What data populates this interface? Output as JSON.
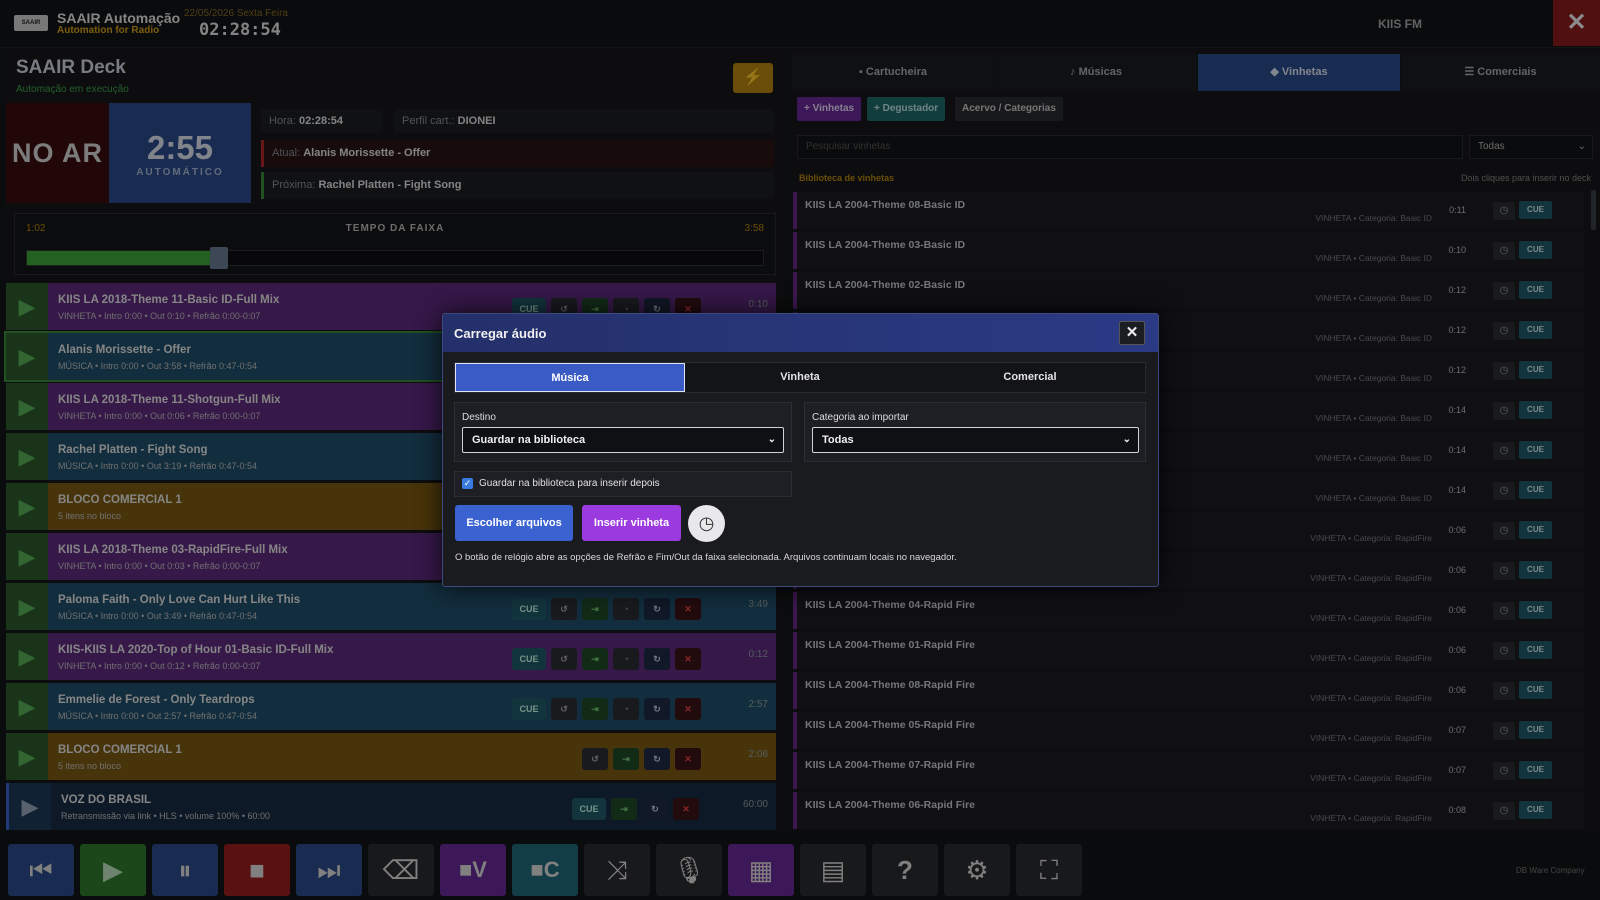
{
  "app": {
    "title": "SAAIR Automação",
    "subtitle": "Automation for Radio",
    "logo_text": "SAAIR",
    "date": "22/05/2026 Sexta Feira",
    "clock": "02:28:54",
    "station": "KIIS FM",
    "close_icon": "close-icon"
  },
  "deck": {
    "title": "SAAIR Deck",
    "status": "Automação em execução",
    "on_air": "NO AR",
    "countdown": "2:55",
    "mode": "AUTOMÁTICO",
    "hora_label": "Hora:",
    "hora": "02:28:54",
    "perfil_label": "Perfil cart.:",
    "perfil": "DIONEI",
    "atual_label": "Atual:",
    "atual": "Alanis Morissette - Offer",
    "proxima_label": "Próxima:",
    "proxima": "Rachel Platten - Fight Song",
    "elapsed": "1:02",
    "track_time_label": "TEMPO DA FAIXA",
    "total": "3:58",
    "progress": 0.26
  },
  "playlist": [
    {
      "title": "KIIS LA 2018-Theme 11-Basic ID-Full Mix",
      "meta": "VINHETA • Intro 0:00 • Out 0:10 • Refrão 0:00-0:07",
      "dur": "0:10",
      "kind": "vinheta",
      "cue": "CUE"
    },
    {
      "title": "Alanis Morissette - Offer",
      "meta": "MÚSICA • Intro 0:00 • Out 3:58 • Refrão 0:47-0:54",
      "dur": "",
      "kind": "musica-active",
      "cue": "CUE"
    },
    {
      "title": "KIIS LA 2018-Theme 11-Shotgun-Full Mix",
      "meta": "VINHETA • Intro 0:00 • Out 0:06 • Refrão 0:00-0:07",
      "dur": "",
      "kind": "vinheta",
      "cue": "CUE"
    },
    {
      "title": "Rachel Platten - Fight Song",
      "meta": "MÚSICA • Intro 0:00 • Out 3:19 • Refrão 0:47-0:54",
      "dur": "",
      "kind": "musica",
      "cue": "CUE"
    },
    {
      "title": "BLOCO COMERCIAL 1",
      "meta": "5 itens no bloco",
      "dur": "",
      "kind": "comercial",
      "cue": "CUE"
    },
    {
      "title": "KIIS LA 2018-Theme 03-RapidFire-Full Mix",
      "meta": "VINHETA • Intro 0:00 • Out 0:03 • Refrão 0:00-0:07",
      "dur": "",
      "kind": "vinheta",
      "cue": "CUE"
    },
    {
      "title": "Paloma Faith - Only Love Can Hurt Like This",
      "meta": "MÚSICA • Intro 0:00 • Out 3:49 • Refrão 0:47-0:54",
      "dur": "3:49",
      "kind": "musica",
      "cue": "CUE"
    },
    {
      "title": "KIIS-KIIS LA 2020-Top of Hour 01-Basic ID-Full Mix",
      "meta": "VINHETA • Intro 0:00 • Out 0:12 • Refrão 0:00-0:07",
      "dur": "0:12",
      "kind": "vinheta",
      "cue": "CUE"
    },
    {
      "title": "Emmelie de Forest - Only Teardrops",
      "meta": "MÚSICA • Intro 0:00 • Out 2:57 • Refrão 0:47-0:54",
      "dur": "2:57",
      "kind": "musica",
      "cue": "CUE"
    },
    {
      "title": "BLOCO COMERCIAL 1",
      "meta": "5 itens no bloco",
      "dur": "2:06",
      "kind": "comercial",
      "cue": ""
    },
    {
      "title": "VOZ DO BRASIL",
      "meta": "Retransmissão via link • HLS • volume 100% • 60:00",
      "dur": "60:00",
      "kind": "voz",
      "cue": "CUE"
    }
  ],
  "tabs": {
    "cartucheira": "Cartucheira",
    "musicas": "Músicas",
    "vinhetas": "Vinhetas",
    "comerciais": "Comerciais"
  },
  "library": {
    "add_vinhetas": "+ Vinhetas",
    "add_degustador": "+ Degustador",
    "acervo": "Acervo / Categorias",
    "search_placeholder": "Pesquisar vinhetas",
    "filter": "Todas",
    "header": "Biblioteca de vinhetas",
    "hint": "Dois cliques para inserir no deck",
    "cue": "CUE",
    "items": [
      {
        "name": "KIIS LA 2004-Theme 08-Basic ID",
        "meta": "VINHETA • Categoria: Basic ID",
        "dur": "0:11"
      },
      {
        "name": "KIIS LA 2004-Theme 03-Basic ID",
        "meta": "VINHETA • Categoria: Basic ID",
        "dur": "0:10"
      },
      {
        "name": "KIIS LA 2004-Theme 02-Basic ID",
        "meta": "VINHETA • Categoria: Basic ID",
        "dur": "0:12"
      },
      {
        "name": "",
        "meta": "VINHETA • Categoria: Basic ID",
        "dur": "0:12"
      },
      {
        "name": "",
        "meta": "VINHETA • Categoria: Basic ID",
        "dur": "0:12"
      },
      {
        "name": "",
        "meta": "VINHETA • Categoria: Basic ID",
        "dur": "0:14"
      },
      {
        "name": "",
        "meta": "VINHETA • Categoria: Basic ID",
        "dur": "0:14"
      },
      {
        "name": "",
        "meta": "VINHETA • Categoria: Basic ID",
        "dur": "0:14"
      },
      {
        "name": "",
        "meta": "VINHETA • Categoria: RapidFire",
        "dur": "0:06"
      },
      {
        "name": "",
        "meta": "VINHETA • Categoria: RapidFire",
        "dur": "0:06"
      },
      {
        "name": "KIIS LA 2004-Theme 04-Rapid Fire",
        "meta": "VINHETA • Categoria: RapidFire",
        "dur": "0:06"
      },
      {
        "name": "KIIS LA 2004-Theme 01-Rapid Fire",
        "meta": "VINHETA • Categoria: RapidFire",
        "dur": "0:06"
      },
      {
        "name": "KIIS LA 2004-Theme 08-Rapid Fire",
        "meta": "VINHETA • Categoria: RapidFire",
        "dur": "0:06"
      },
      {
        "name": "KIIS LA 2004-Theme 05-Rapid Fire",
        "meta": "VINHETA • Categoria: RapidFire",
        "dur": "0:07"
      },
      {
        "name": "KIIS LA 2004-Theme 07-Rapid Fire",
        "meta": "VINHETA • Categoria: RapidFire",
        "dur": "0:07"
      },
      {
        "name": "KIIS LA 2004-Theme 06-Rapid Fire",
        "meta": "VINHETA • Categoria: RapidFire",
        "dur": "0:08"
      }
    ]
  },
  "modal": {
    "title": "Carregar áudio",
    "tabs": [
      "Música",
      "Vinheta",
      "Comercial"
    ],
    "destino_label": "Destino",
    "destino": "Guardar na biblioteca",
    "categoria_label": "Categoria ao importar",
    "categoria": "Todas",
    "checkbox": "Guardar na biblioteca para inserir depois",
    "choose": "Escolher arquivos",
    "insert": "Inserir vinheta",
    "note": "O botão de relógio abre as opções de Refrão e Fim/Out da faixa selecionada. Arquivos continuam locais no navegador."
  },
  "bottom": {
    "v_label": "V",
    "c_label": "C",
    "credit": "DB Ware Company"
  },
  "colors": {
    "vinheta": "#5e2a7e",
    "musica": "#1f4f6a",
    "comercial": "#7a5a12",
    "voz": "#182c44",
    "accent": "#3a5bc4"
  }
}
